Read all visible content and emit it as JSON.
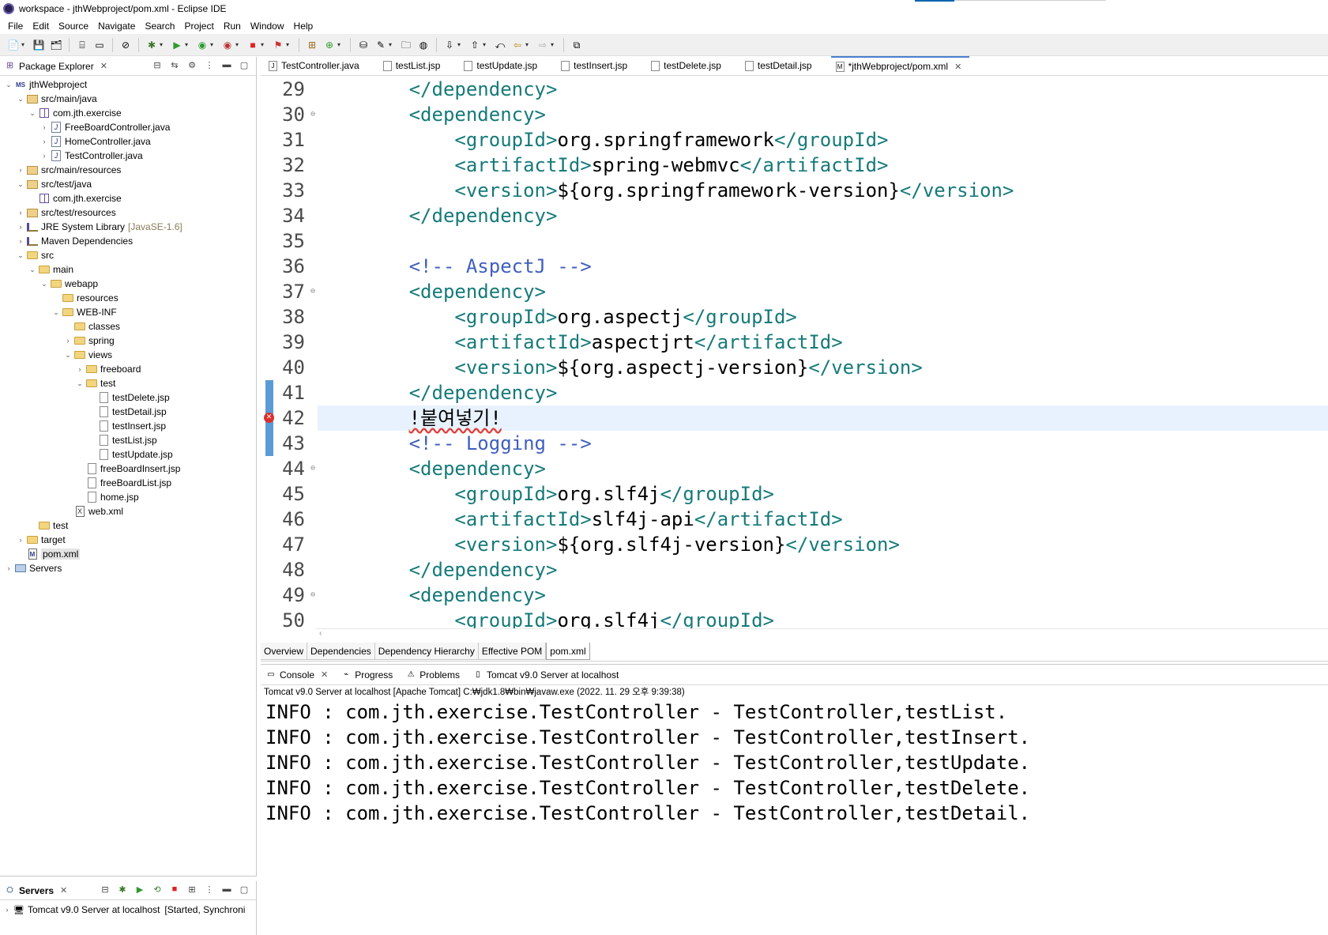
{
  "window": {
    "title": "workspace - jthWebproject/pom.xml - Eclipse IDE"
  },
  "menu": [
    "File",
    "Edit",
    "Source",
    "Navigate",
    "Search",
    "Project",
    "Run",
    "Window",
    "Help"
  ],
  "package_explorer": {
    "title": "Package Explorer",
    "tree": [
      {
        "label": "jthWebproject",
        "icon": "project-icon",
        "twisty": "open",
        "indent": 0
      },
      {
        "label": "src/main/java",
        "icon": "source-folder-icon",
        "twisty": "open",
        "indent": 1
      },
      {
        "label": "com.jth.exercise",
        "icon": "package-icon",
        "twisty": "open",
        "indent": 2
      },
      {
        "label": "FreeBoardController.java",
        "icon": "java-file-icon",
        "twisty": "closed",
        "indent": 3
      },
      {
        "label": "HomeController.java",
        "icon": "java-file-icon",
        "twisty": "closed",
        "indent": 3
      },
      {
        "label": "TestController.java",
        "icon": "java-file-icon",
        "twisty": "closed",
        "indent": 3
      },
      {
        "label": "src/main/resources",
        "icon": "source-folder-icon",
        "twisty": "closed",
        "indent": 1
      },
      {
        "label": "src/test/java",
        "icon": "source-folder-icon",
        "twisty": "open",
        "indent": 1
      },
      {
        "label": "com.jth.exercise",
        "icon": "package-icon",
        "twisty": "none",
        "indent": 2
      },
      {
        "label": "src/test/resources",
        "icon": "source-folder-icon",
        "twisty": "closed",
        "indent": 1
      },
      {
        "label": "JRE System Library",
        "decoration": "[JavaSE-1.6]",
        "icon": "library-icon",
        "twisty": "closed",
        "indent": 1
      },
      {
        "label": "Maven Dependencies",
        "icon": "library-icon",
        "twisty": "closed",
        "indent": 1
      },
      {
        "label": "src",
        "icon": "folder-icon",
        "twisty": "open",
        "indent": 1
      },
      {
        "label": "main",
        "icon": "folder-icon",
        "twisty": "open",
        "indent": 2
      },
      {
        "label": "webapp",
        "icon": "folder-icon",
        "twisty": "open",
        "indent": 3
      },
      {
        "label": "resources",
        "icon": "folder-icon",
        "twisty": "none",
        "indent": 4
      },
      {
        "label": "WEB-INF",
        "icon": "folder-icon",
        "twisty": "open",
        "indent": 4
      },
      {
        "label": "classes",
        "icon": "folder-icon",
        "twisty": "none",
        "indent": 5
      },
      {
        "label": "spring",
        "icon": "folder-icon",
        "twisty": "closed",
        "indent": 5
      },
      {
        "label": "views",
        "icon": "folder-icon",
        "twisty": "open",
        "indent": 5
      },
      {
        "label": "freeboard",
        "icon": "folder-icon",
        "twisty": "closed",
        "indent": 6
      },
      {
        "label": "test",
        "icon": "folder-icon",
        "twisty": "open",
        "indent": 6
      },
      {
        "label": "testDelete.jsp",
        "icon": "file-icon",
        "twisty": "none",
        "indent": 7
      },
      {
        "label": "testDetail.jsp",
        "icon": "file-icon",
        "twisty": "none",
        "indent": 7
      },
      {
        "label": "testInsert.jsp",
        "icon": "file-icon",
        "twisty": "none",
        "indent": 7
      },
      {
        "label": "testList.jsp",
        "icon": "file-icon",
        "twisty": "none",
        "indent": 7
      },
      {
        "label": "testUpdate.jsp",
        "icon": "file-icon",
        "twisty": "none",
        "indent": 7
      },
      {
        "label": "freeBoardInsert.jsp",
        "icon": "file-icon",
        "twisty": "none",
        "indent": 6
      },
      {
        "label": "freeBoardList.jsp",
        "icon": "file-icon",
        "twisty": "none",
        "indent": 6
      },
      {
        "label": "home.jsp",
        "icon": "file-icon",
        "twisty": "none",
        "indent": 6
      },
      {
        "label": "web.xml",
        "icon": "xml-file-icon",
        "twisty": "none",
        "indent": 5
      },
      {
        "label": "test",
        "icon": "folder-icon",
        "twisty": "none",
        "indent": 2
      },
      {
        "label": "target",
        "icon": "folder-icon",
        "twisty": "closed",
        "indent": 1
      },
      {
        "label": "pom.xml",
        "icon": "maven-file-icon",
        "twisty": "none",
        "indent": 1,
        "selected": true
      },
      {
        "label": "Servers",
        "icon": "servers-folder-icon",
        "twisty": "closed",
        "indent": 0
      }
    ]
  },
  "servers_view": {
    "title": "Servers",
    "server_entry": "Tomcat v9.0 Server at localhost",
    "server_status": "[Started, Synchroni"
  },
  "editor": {
    "tabs": [
      {
        "label": "TestController.java",
        "icon": "J"
      },
      {
        "label": "testList.jsp",
        "icon": ""
      },
      {
        "label": "testUpdate.jsp",
        "icon": ""
      },
      {
        "label": "testInsert.jsp",
        "icon": ""
      },
      {
        "label": "testDelete.jsp",
        "icon": ""
      },
      {
        "label": "testDetail.jsp",
        "icon": ""
      },
      {
        "label": "*jthWebproject/pom.xml",
        "icon": "M",
        "active": true
      }
    ],
    "lines": [
      {
        "n": "29",
        "fold": false,
        "segments": [
          {
            "t": "        "
          },
          {
            "t": "</dependency>",
            "c": "tag"
          }
        ]
      },
      {
        "n": "30",
        "fold": true,
        "segments": [
          {
            "t": "        "
          },
          {
            "t": "<dependency>",
            "c": "tag"
          }
        ]
      },
      {
        "n": "31",
        "fold": false,
        "segments": [
          {
            "t": "            "
          },
          {
            "t": "<groupId>",
            "c": "tag"
          },
          {
            "t": "org.springframework"
          },
          {
            "t": "</groupId>",
            "c": "tag"
          }
        ]
      },
      {
        "n": "32",
        "fold": false,
        "segments": [
          {
            "t": "            "
          },
          {
            "t": "<artifactId>",
            "c": "tag"
          },
          {
            "t": "spring-webmvc"
          },
          {
            "t": "</artifactId>",
            "c": "tag"
          }
        ]
      },
      {
        "n": "33",
        "fold": false,
        "segments": [
          {
            "t": "            "
          },
          {
            "t": "<version>",
            "c": "tag"
          },
          {
            "t": "${org.springframework-version}"
          },
          {
            "t": "</version>",
            "c": "tag"
          }
        ]
      },
      {
        "n": "34",
        "fold": false,
        "segments": [
          {
            "t": "        "
          },
          {
            "t": "</dependency>",
            "c": "tag"
          }
        ]
      },
      {
        "n": "35",
        "fold": false,
        "segments": [
          {
            "t": ""
          }
        ]
      },
      {
        "n": "36",
        "fold": false,
        "segments": [
          {
            "t": "        "
          },
          {
            "t": "<!-- AspectJ -->",
            "c": "comment"
          }
        ]
      },
      {
        "n": "37",
        "fold": true,
        "segments": [
          {
            "t": "        "
          },
          {
            "t": "<dependency>",
            "c": "tag"
          }
        ]
      },
      {
        "n": "38",
        "fold": false,
        "segments": [
          {
            "t": "            "
          },
          {
            "t": "<groupId>",
            "c": "tag"
          },
          {
            "t": "org.aspectj"
          },
          {
            "t": "</groupId>",
            "c": "tag"
          }
        ]
      },
      {
        "n": "39",
        "fold": false,
        "segments": [
          {
            "t": "            "
          },
          {
            "t": "<artifactId>",
            "c": "tag"
          },
          {
            "t": "aspectjrt"
          },
          {
            "t": "</artifactId>",
            "c": "tag"
          }
        ]
      },
      {
        "n": "40",
        "fold": false,
        "segments": [
          {
            "t": "            "
          },
          {
            "t": "<version>",
            "c": "tag"
          },
          {
            "t": "${org.aspectj-version}"
          },
          {
            "t": "</version>",
            "c": "tag"
          }
        ]
      },
      {
        "n": "41",
        "fold": false,
        "changed": true,
        "segments": [
          {
            "t": "        "
          },
          {
            "t": "</dependency>",
            "c": "tag"
          }
        ]
      },
      {
        "n": "42",
        "fold": false,
        "changed": true,
        "error": true,
        "current": true,
        "segments": [
          {
            "t": "        "
          },
          {
            "t": "!붙여넣기!",
            "c": "err-text"
          }
        ]
      },
      {
        "n": "43",
        "fold": false,
        "changed": true,
        "segments": [
          {
            "t": "        "
          },
          {
            "t": "<!-- Logging -->",
            "c": "comment"
          }
        ]
      },
      {
        "n": "44",
        "fold": true,
        "segments": [
          {
            "t": "        "
          },
          {
            "t": "<dependency>",
            "c": "tag"
          }
        ]
      },
      {
        "n": "45",
        "fold": false,
        "segments": [
          {
            "t": "            "
          },
          {
            "t": "<groupId>",
            "c": "tag"
          },
          {
            "t": "org.slf4j"
          },
          {
            "t": "</groupId>",
            "c": "tag"
          }
        ]
      },
      {
        "n": "46",
        "fold": false,
        "segments": [
          {
            "t": "            "
          },
          {
            "t": "<artifactId>",
            "c": "tag"
          },
          {
            "t": "slf4j-api"
          },
          {
            "t": "</artifactId>",
            "c": "tag"
          }
        ]
      },
      {
        "n": "47",
        "fold": false,
        "segments": [
          {
            "t": "            "
          },
          {
            "t": "<version>",
            "c": "tag"
          },
          {
            "t": "${org.slf4j-version}"
          },
          {
            "t": "</version>",
            "c": "tag"
          }
        ]
      },
      {
        "n": "48",
        "fold": false,
        "segments": [
          {
            "t": "        "
          },
          {
            "t": "</dependency>",
            "c": "tag"
          }
        ]
      },
      {
        "n": "49",
        "fold": true,
        "segments": [
          {
            "t": "        "
          },
          {
            "t": "<dependency>",
            "c": "tag"
          }
        ]
      },
      {
        "n": "50",
        "fold": false,
        "segments": [
          {
            "t": "            "
          },
          {
            "t": "<groupId>",
            "c": "tag"
          },
          {
            "t": "org.slf4j"
          },
          {
            "t": "</groupId>",
            "c": "tag"
          }
        ]
      }
    ],
    "pom_tabs": [
      {
        "label": "Overview"
      },
      {
        "label": "Dependencies"
      },
      {
        "label": "Dependency Hierarchy"
      },
      {
        "label": "Effective POM"
      },
      {
        "label": "pom.xml",
        "active": true
      }
    ]
  },
  "console": {
    "tabs": [
      {
        "label": "Console",
        "icon": "console-icon",
        "closable": true
      },
      {
        "label": "Progress",
        "icon": "progress-icon"
      },
      {
        "label": "Problems",
        "icon": "problems-icon"
      },
      {
        "label": "Tomcat v9.0 Server at localhost",
        "icon": "server-icon"
      }
    ],
    "description": "Tomcat v9.0 Server at localhost [Apache Tomcat] C:₩jdk1.8₩bin₩javaw.exe  (2022. 11. 29 오후 9:39:38)",
    "output": [
      "INFO : com.jth.exercise.TestController - TestController,testList.",
      "INFO : com.jth.exercise.TestController - TestController,testInsert.",
      "INFO : com.jth.exercise.TestController - TestController,testUpdate.",
      "INFO : com.jth.exercise.TestController - TestController,testDelete.",
      "INFO : com.jth.exercise.TestController - TestController,testDetail."
    ]
  },
  "colors": {
    "xml_tag": "#177a7a",
    "xml_comment": "#3f5fbf",
    "current_line": "#e8f2fe",
    "change_marker": "#5b9bd5",
    "error": "#d9302b"
  }
}
